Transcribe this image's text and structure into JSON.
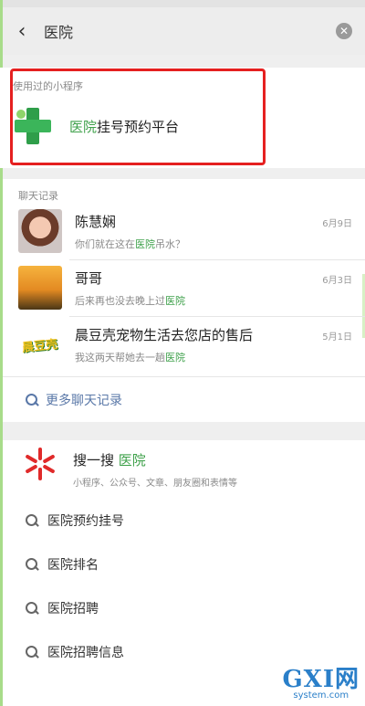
{
  "searchbar": {
    "query": "医院"
  },
  "mini_programs": {
    "title": "使用过的小程序",
    "items": [
      {
        "name_highlight": "医院",
        "name_rest": "挂号预约平台"
      }
    ]
  },
  "chat_records": {
    "title": "聊天记录",
    "items": [
      {
        "name": "陈慧娴",
        "time": "6月9日",
        "msg_before": "你们就在这在",
        "msg_highlight": "医院",
        "msg_after": "吊水？"
      },
      {
        "name": "哥哥",
        "time": "6月3日",
        "msg_before": "后来再也没去晚上过",
        "msg_highlight": "医院",
        "msg_after": ""
      },
      {
        "name": "晨豆壳宠物生活去您店的售后",
        "time": "5月1日",
        "msg_before": "我这两天帮她去一趟",
        "msg_highlight": "医院",
        "msg_after": "",
        "avatar_text": "晨豆壳"
      }
    ],
    "more_label": "更多聊天记录"
  },
  "sou_yi_sou": {
    "title": "搜一搜",
    "query": "医院",
    "subtitle": "小程序、公众号、文章、朋友圈和表情等"
  },
  "suggestions": [
    "医院预约挂号",
    "医院排名",
    "医院招聘",
    "医院招聘信息"
  ],
  "watermark": {
    "logo": "GXI网",
    "sub": "system.com"
  }
}
